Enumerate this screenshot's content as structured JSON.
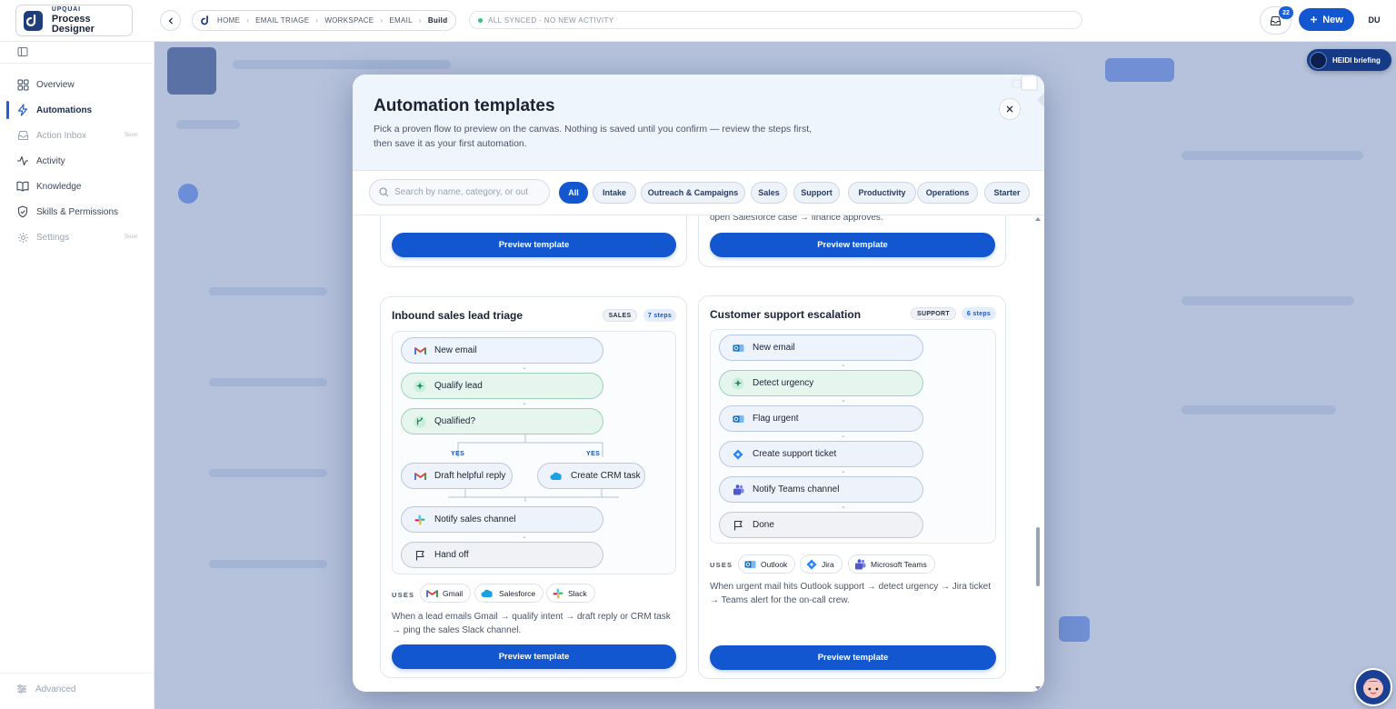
{
  "brand": {
    "top": "UPQUAI",
    "name": "Process Designer"
  },
  "breadcrumbs": [
    "HOME",
    "EMAIL TRIAGE",
    "WORKSPACE",
    "EMAIL",
    "Build"
  ],
  "status": "ALL SYNCED · NO NEW ACTIVITY",
  "inbox_count": "22",
  "new_label": "New",
  "avatar": "DU",
  "sidebar": {
    "items": [
      {
        "label": "Overview",
        "icon": "grid-icon",
        "state": "normal",
        "soon": ""
      },
      {
        "label": "Automations",
        "icon": "bolt-icon",
        "state": "active",
        "soon": ""
      },
      {
        "label": "Action Inbox",
        "icon": "inbox-icon",
        "state": "muted",
        "soon": "Soon"
      },
      {
        "label": "Activity",
        "icon": "activity-icon",
        "state": "normal",
        "soon": ""
      },
      {
        "label": "Knowledge",
        "icon": "book-icon",
        "state": "normal",
        "soon": ""
      },
      {
        "label": "Skills & Permissions",
        "icon": "shield-icon",
        "state": "normal",
        "soon": ""
      },
      {
        "label": "Settings",
        "icon": "gear-icon",
        "state": "muted",
        "soon": "Soon"
      }
    ],
    "advanced": "Advanced"
  },
  "heidi": "HEIDI briefing",
  "modal": {
    "title": "Automation templates",
    "description": "Pick a proven flow to preview on the canvas. Nothing is saved until you confirm — review the steps first, then save it as your first automation.",
    "search_placeholder": "Search by name, category, or out",
    "filters": [
      "All",
      "Intake",
      "Outreach & Campaigns",
      "Sales",
      "Support",
      "Productivity",
      "Operations",
      "Starter"
    ],
    "active_filter": "All",
    "preview_label": "Preview template",
    "uses_label": "USES",
    "yes_label": "YES",
    "partial_right_desc": "When invoice emails arrive in Outlook → extract fields → label AP → open Salesforce case → finance approves.",
    "cards": [
      {
        "title": "Inbound sales lead triage",
        "category": "SALES",
        "steps": "7 steps",
        "nodes": [
          {
            "label": "New email",
            "icon": "gmail-icon",
            "kind": "trig"
          },
          {
            "label": "Qualify lead",
            "icon": "sparkle-icon",
            "kind": "ai"
          },
          {
            "label": "Qualified?",
            "icon": "branch-icon",
            "kind": "ai"
          },
          {
            "label": "Draft helpful reply",
            "icon": "gmail-icon",
            "kind": "act"
          },
          {
            "label": "Create CRM task",
            "icon": "salesforce-icon",
            "kind": "act"
          },
          {
            "label": "Notify sales channel",
            "icon": "slack-icon",
            "kind": "act"
          },
          {
            "label": "Hand off",
            "icon": "flag-icon",
            "kind": "end"
          }
        ],
        "uses": [
          {
            "label": "Gmail",
            "icon": "gmail-icon"
          },
          {
            "label": "Salesforce",
            "icon": "salesforce-icon"
          },
          {
            "label": "Slack",
            "icon": "slack-icon"
          }
        ],
        "description": "When a lead emails Gmail → qualify intent → draft reply or CRM task → ping the sales Slack channel."
      },
      {
        "title": "Customer support escalation",
        "category": "SUPPORT",
        "steps": "6 steps",
        "nodes": [
          {
            "label": "New email",
            "icon": "outlook-icon",
            "kind": "trig"
          },
          {
            "label": "Detect urgency",
            "icon": "sparkle-icon",
            "kind": "ai"
          },
          {
            "label": "Flag urgent",
            "icon": "outlook-icon",
            "kind": "act"
          },
          {
            "label": "Create support ticket",
            "icon": "jira-icon",
            "kind": "act"
          },
          {
            "label": "Notify Teams channel",
            "icon": "teams-icon",
            "kind": "act"
          },
          {
            "label": "Done",
            "icon": "flag-icon",
            "kind": "end"
          }
        ],
        "uses": [
          {
            "label": "Outlook",
            "icon": "outlook-icon"
          },
          {
            "label": "Jira",
            "icon": "jira-icon"
          },
          {
            "label": "Microsoft Teams",
            "icon": "teams-icon"
          }
        ],
        "description": "When urgent mail hits Outlook support → detect urgency → Jira ticket → Teams alert for the on-call crew."
      }
    ]
  },
  "colors": {
    "primary": "#1256d0",
    "ai_green": "#e6f6ef",
    "overlay": "#b6c2dc"
  }
}
